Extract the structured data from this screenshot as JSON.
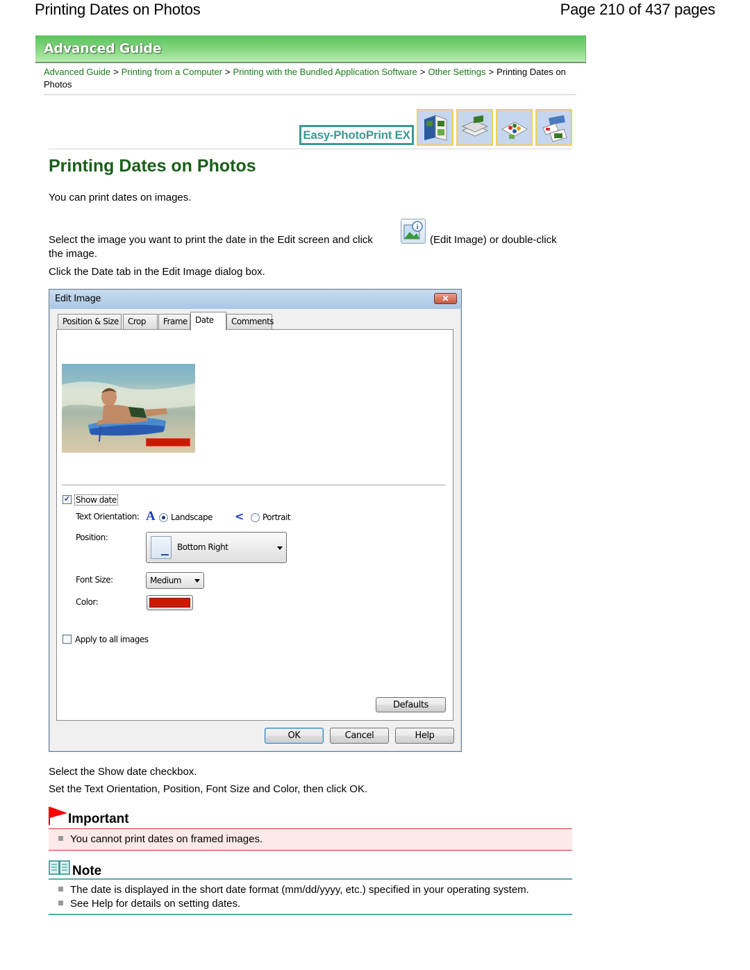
{
  "header": {
    "title": "Printing Dates on Photos",
    "page_indicator": "Page 210 of 437 pages"
  },
  "banner": {
    "label": "Advanced Guide"
  },
  "breadcrumb": {
    "items": [
      "Advanced Guide",
      "Printing from a Computer",
      "Printing with the Bundled Application Software",
      "Other Settings"
    ],
    "separator": ">",
    "current": "Printing Dates on Photos"
  },
  "product": {
    "logo_text": "Easy-PhotoPrint EX",
    "icons": [
      "album-icon",
      "calendar-layout-icon",
      "stickers-icon",
      "layout-print-icon"
    ]
  },
  "page": {
    "heading": "Printing Dates on Photos",
    "intro": "You can print dates on images.",
    "step1_before": "Select the image you want to print the date in the Edit screen and click",
    "step1_after": "(Edit Image) or double-click",
    "step1_line2": "the image.",
    "step2": "Click the Date tab in the Edit Image dialog box.",
    "step3": "Select the Show date checkbox.",
    "step4": "Set the Text Orientation, Position, Font Size and Color, then click OK."
  },
  "dialog": {
    "title": "Edit Image",
    "close_label": "✕",
    "tabs": [
      {
        "label": "Position & Size",
        "active": false
      },
      {
        "label": "Crop",
        "active": false
      },
      {
        "label": "Frame",
        "active": false
      },
      {
        "label": "Date",
        "active": true
      },
      {
        "label": "Comments",
        "active": false
      }
    ],
    "show_date": {
      "label": "Show date",
      "checked": true
    },
    "text_orientation": {
      "label": "Text Orientation:",
      "options": [
        {
          "label": "Landscape",
          "selected": true
        },
        {
          "label": "Portrait",
          "selected": false
        }
      ]
    },
    "position": {
      "label": "Position:",
      "value": "Bottom Right"
    },
    "font_size": {
      "label": "Font Size:",
      "value": "Medium"
    },
    "color": {
      "label": "Color:",
      "value": "#cc1a00"
    },
    "apply_all": {
      "label": "Apply to all images",
      "checked": false
    },
    "buttons": {
      "defaults": "Defaults",
      "ok": "OK",
      "cancel": "Cancel",
      "help": "Help"
    }
  },
  "important": {
    "title": "Important",
    "items": [
      "You cannot print dates on framed images."
    ]
  },
  "note": {
    "title": "Note",
    "items": [
      "The date is displayed in the short date format (mm/dd/yyyy, etc.) specified in your operating system.",
      "See Help for details on setting dates."
    ]
  },
  "colors": {
    "heading_green": "#1a5e1a",
    "link_green": "#1a7a1a",
    "important_red": "#d33a3a",
    "note_teal": "#5aa8a8",
    "date_color": "#cc1a00"
  }
}
